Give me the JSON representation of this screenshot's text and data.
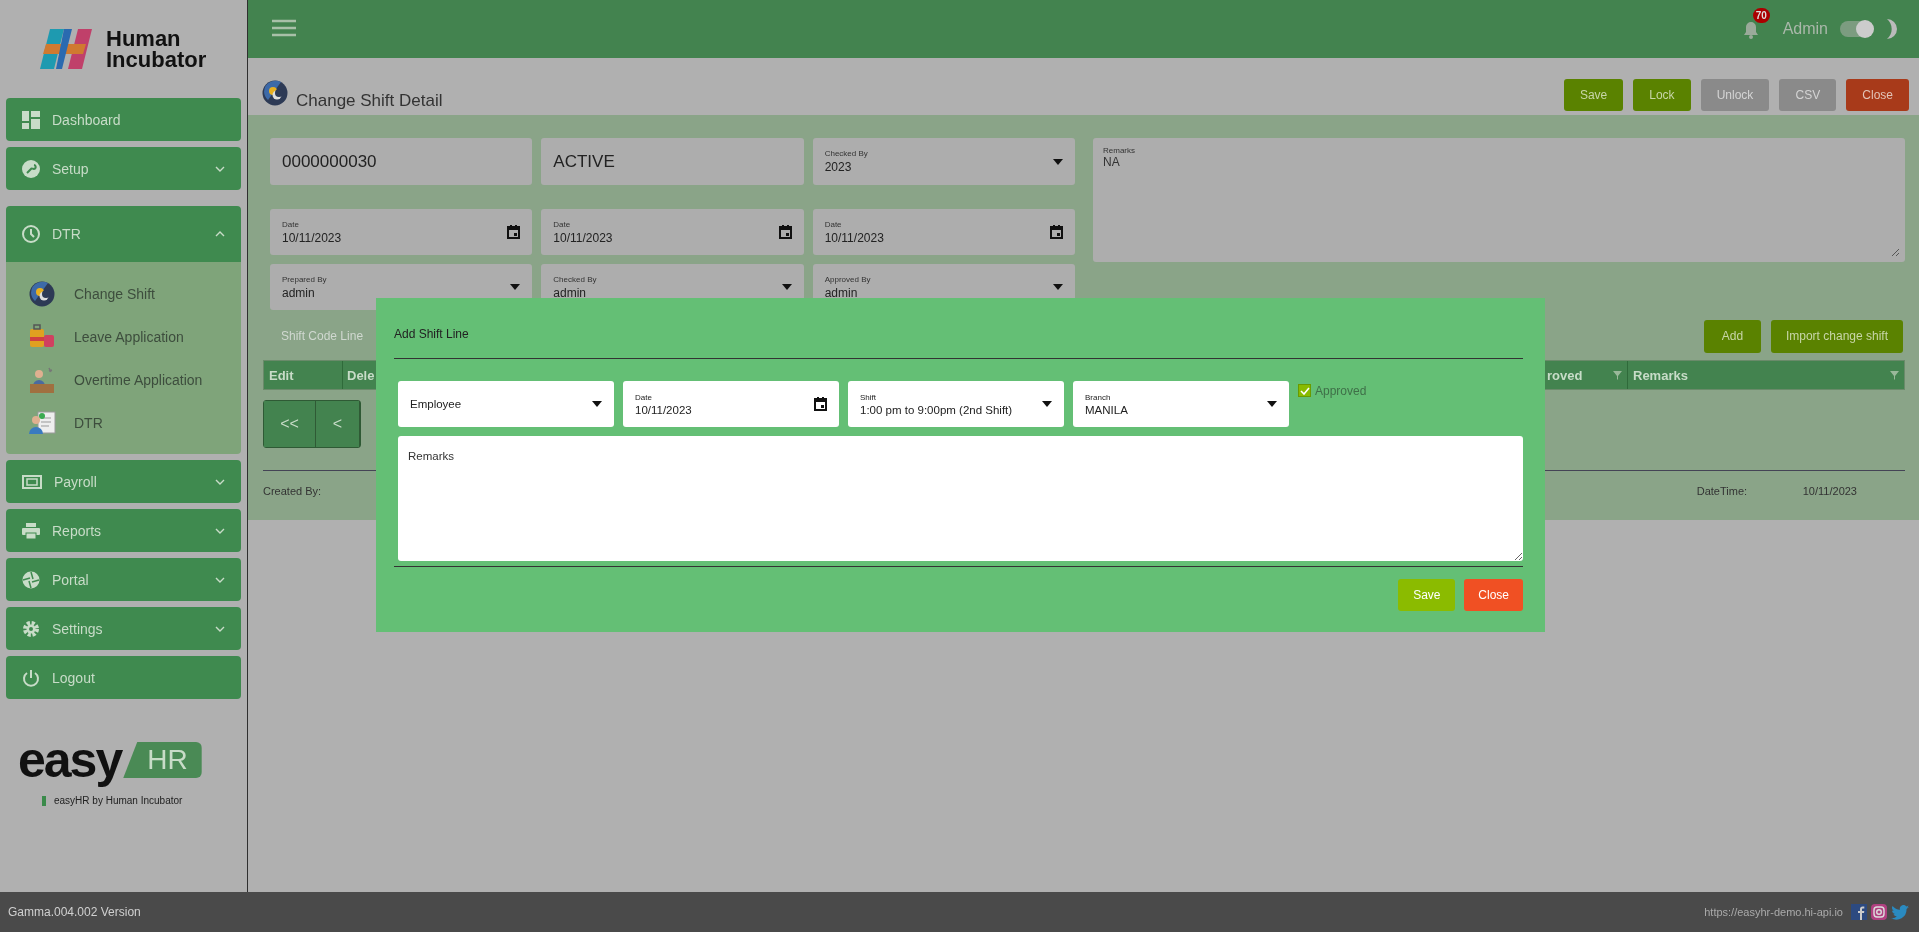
{
  "brand": {
    "line_1": "Human",
    "line_2": "Incubator"
  },
  "sidebar": {
    "items": [
      {
        "kind": "link",
        "label": "Dashboard"
      },
      {
        "kind": "group",
        "label": "Setup",
        "expanded": false
      },
      {
        "kind": "group",
        "label": "DTR",
        "expanded": true,
        "children": [
          {
            "label": "Change Shift"
          },
          {
            "label": "Leave Application"
          },
          {
            "label": "Overtime Application"
          },
          {
            "label": "DTR"
          }
        ]
      },
      {
        "kind": "group",
        "label": "Payroll",
        "expanded": false
      },
      {
        "kind": "group",
        "label": "Reports",
        "expanded": false
      },
      {
        "kind": "group",
        "label": "Portal",
        "expanded": false
      },
      {
        "kind": "group",
        "label": "Settings",
        "expanded": false
      },
      {
        "kind": "link",
        "label": "Logout"
      }
    ]
  },
  "product_logo": {
    "main": "easy",
    "badge": "HR",
    "tagline": "easyHR by Human Incubator"
  },
  "header": {
    "notification_count": "70",
    "user": "Admin",
    "theme_toggle_on": true
  },
  "page": {
    "title": "Change Shift Detail",
    "actions": [
      {
        "label": "Save",
        "kind": "primary",
        "disabled": false
      },
      {
        "label": "Lock",
        "kind": "primary",
        "disabled": false
      },
      {
        "label": "Unlock",
        "kind": "primary",
        "disabled": true
      },
      {
        "label": "CSV",
        "kind": "primary",
        "disabled": true
      },
      {
        "label": "Close",
        "kind": "danger",
        "disabled": false
      }
    ]
  },
  "form": {
    "fields": [
      {
        "kind": "text",
        "value": "0000000030"
      },
      {
        "kind": "text",
        "value": "ACTIVE"
      },
      {
        "kind": "select",
        "label": "Checked By",
        "value": "2023"
      },
      {
        "kind": "date",
        "label": "Date",
        "value": "10/11/2023"
      },
      {
        "kind": "date",
        "label": "Date",
        "value": "10/11/2023"
      },
      {
        "kind": "date",
        "label": "Date",
        "value": "10/11/2023"
      },
      {
        "kind": "select",
        "label": "Prepared By",
        "value": "admin"
      },
      {
        "kind": "select",
        "label": "Checked By",
        "value": "admin"
      },
      {
        "kind": "select",
        "label": "Approved By",
        "value": "admin"
      }
    ],
    "remarks": {
      "label": "Remarks",
      "value": "NA"
    }
  },
  "lines": {
    "tab": "Shift Code Line",
    "actions": [
      {
        "label": "Add"
      },
      {
        "label": "Import change shift"
      }
    ],
    "columns": [
      {
        "label": "Edit",
        "filter": false
      },
      {
        "label": "Dele"
      },
      {
        "label": "roved",
        "filter": true
      },
      {
        "label": "Remarks",
        "filter": true
      }
    ],
    "pagination": [
      {
        "label": "<<"
      },
      {
        "label": "<"
      }
    ]
  },
  "audit": [
    {
      "label": "Created By:"
    },
    {
      "label": "DateTime:",
      "value": "10/11/2023"
    }
  ],
  "modal": {
    "title": "Add Shift Line",
    "fields": [
      {
        "kind": "select",
        "placeholder": "Employee"
      },
      {
        "kind": "date",
        "label": "Date",
        "value": "10/11/2023"
      },
      {
        "kind": "select",
        "label": "Shift",
        "value": "1:00 pm to 9:00pm (2nd Shift)"
      },
      {
        "kind": "select",
        "label": "Branch",
        "value": "MANILA"
      }
    ],
    "approved": {
      "label": "Approved",
      "checked": true
    },
    "remarks": {
      "placeholder": "Remarks"
    },
    "buttons": [
      {
        "label": "Save",
        "kind": "primary"
      },
      {
        "label": "Close",
        "kind": "danger"
      }
    ]
  },
  "footer": {
    "version": "Gamma.004.002 Version",
    "url": "https://easyhr-demo.hi-api.io"
  }
}
